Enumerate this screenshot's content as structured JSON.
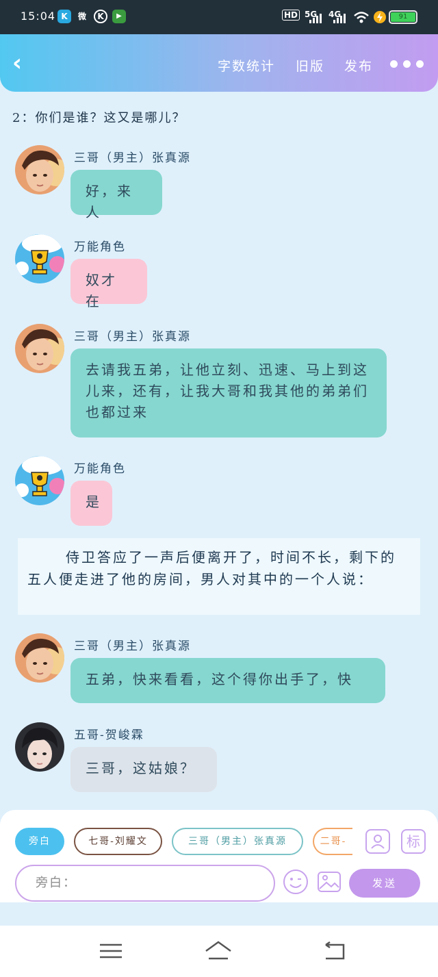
{
  "status_bar": {
    "time": "15:04",
    "apps": [
      "K",
      "微",
      "K",
      "▶"
    ],
    "hd_label": "HD",
    "net_5g": "5G",
    "net_4g": "4G",
    "battery_text": "91"
  },
  "header": {
    "word_count": "字数统计",
    "old_version": "旧版",
    "publish": "发布"
  },
  "content": {
    "question": "2：你们是谁？这又是哪儿？",
    "narration": "侍卫答应了一声后便离开了，时间不长，剩下的五人便走进了他的房间，男人对其中的一个人说："
  },
  "messages": [
    {
      "name": "三哥（男主）张真源",
      "text": "好，来人",
      "style": "teal",
      "avatar": "boy-avatar"
    },
    {
      "name": "万能角色",
      "text": "奴才在",
      "style": "pink",
      "avatar": "trophy-avatar"
    },
    {
      "name": "三哥（男主）张真源",
      "text": "去请我五弟，让他立刻、迅速、马上到这儿来，还有，让我大哥和我其他的弟弟们也都过来",
      "style": "teal",
      "avatar": "boy-avatar"
    },
    {
      "name": "万能角色",
      "text": "是",
      "style": "pink",
      "avatar": "trophy-avatar"
    },
    {
      "name": "三哥（男主）张真源",
      "text": "五弟，快来看看，这个得你出手了，快",
      "style": "teal",
      "avatar": "boy-avatar"
    },
    {
      "name": "五哥-贺峻霖",
      "text": "三哥，这姑娘？",
      "style": "gray",
      "avatar": "dark-hair-avatar"
    }
  ],
  "composer": {
    "chips": [
      "旁白",
      "七哥-刘耀文",
      "三哥（男主）张真源",
      "二哥-"
    ],
    "input_placeholder": "旁白：",
    "send_label": "发送",
    "tag_icon_label": "标"
  },
  "colors": {
    "teal_bubble": "#86d7cf",
    "pink_bubble": "#fbc7d6",
    "gray_bubble": "#dde3ea",
    "accent_purple": "#c397ec",
    "accent_blue": "#4cc1ef"
  }
}
